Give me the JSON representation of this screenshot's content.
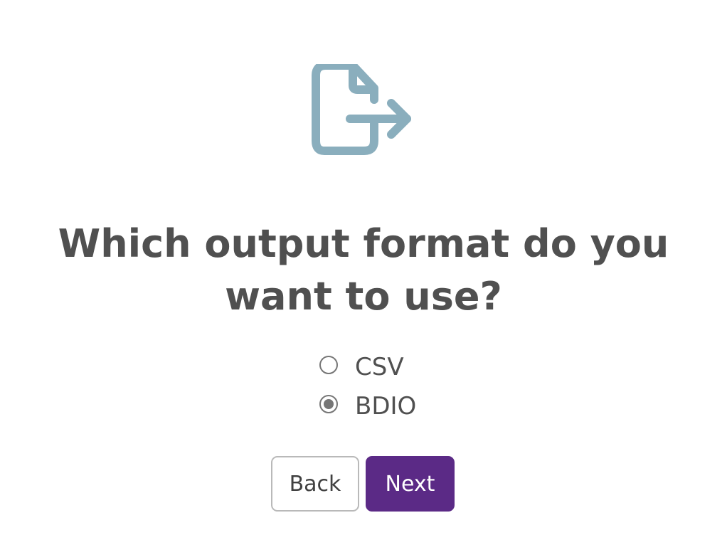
{
  "icon": {
    "name": "file-export-icon",
    "color": "#8aaebd"
  },
  "question": {
    "line1": "Which output format do you",
    "line2": "want to use?"
  },
  "options": [
    {
      "label": "CSV",
      "selected": false
    },
    {
      "label": "BDIO",
      "selected": true
    }
  ],
  "buttons": {
    "back_label": "Back",
    "next_label": "Next",
    "next_color": "#5b2a86"
  }
}
